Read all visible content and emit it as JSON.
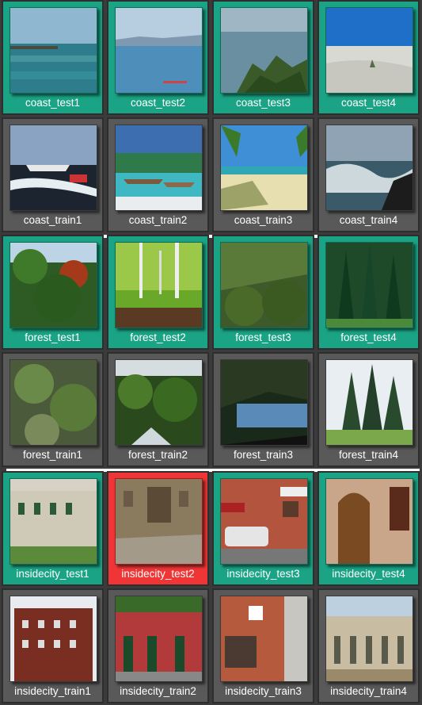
{
  "grid": {
    "groups": [
      {
        "category": "coast",
        "rows": [
          {
            "kind": "test",
            "tiles": [
              {
                "label": "coast_test1",
                "icon": "coast-photo",
                "status": "ok"
              },
              {
                "label": "coast_test2",
                "icon": "coast-photo",
                "status": "ok"
              },
              {
                "label": "coast_test3",
                "icon": "coast-photo",
                "status": "ok"
              },
              {
                "label": "coast_test4",
                "icon": "coast-photo",
                "status": "ok"
              }
            ]
          },
          {
            "kind": "train",
            "tiles": [
              {
                "label": "coast_train1",
                "icon": "coast-photo"
              },
              {
                "label": "coast_train2",
                "icon": "coast-photo"
              },
              {
                "label": "coast_train3",
                "icon": "coast-photo"
              },
              {
                "label": "coast_train4",
                "icon": "coast-photo"
              }
            ]
          }
        ]
      },
      {
        "category": "forest",
        "rows": [
          {
            "kind": "test",
            "tiles": [
              {
                "label": "forest_test1",
                "icon": "forest-photo",
                "status": "ok"
              },
              {
                "label": "forest_test2",
                "icon": "forest-photo",
                "status": "ok"
              },
              {
                "label": "forest_test3",
                "icon": "forest-photo",
                "status": "ok"
              },
              {
                "label": "forest_test4",
                "icon": "forest-photo",
                "status": "ok"
              }
            ]
          },
          {
            "kind": "train",
            "tiles": [
              {
                "label": "forest_train1",
                "icon": "forest-photo"
              },
              {
                "label": "forest_train2",
                "icon": "forest-photo"
              },
              {
                "label": "forest_train3",
                "icon": "forest-photo"
              },
              {
                "label": "forest_train4",
                "icon": "forest-photo"
              }
            ]
          }
        ]
      },
      {
        "category": "insidecity",
        "rows": [
          {
            "kind": "test",
            "tiles": [
              {
                "label": "insidecity_test1",
                "icon": "city-photo",
                "status": "ok"
              },
              {
                "label": "insidecity_test2",
                "icon": "city-photo",
                "status": "error"
              },
              {
                "label": "insidecity_test3",
                "icon": "city-photo",
                "status": "ok"
              },
              {
                "label": "insidecity_test4",
                "icon": "city-photo",
                "status": "ok"
              }
            ]
          },
          {
            "kind": "train",
            "tiles": [
              {
                "label": "insidecity_train1",
                "icon": "city-photo"
              },
              {
                "label": "insidecity_train2",
                "icon": "city-photo"
              },
              {
                "label": "insidecity_train3",
                "icon": "city-photo"
              },
              {
                "label": "insidecity_train4",
                "icon": "city-photo"
              }
            ]
          }
        ]
      }
    ]
  },
  "colors": {
    "test_ok": "#1aa384",
    "test_error": "#ef3535",
    "train": "#595959",
    "separator": "#ffffff",
    "background": "#3b3b3b"
  }
}
